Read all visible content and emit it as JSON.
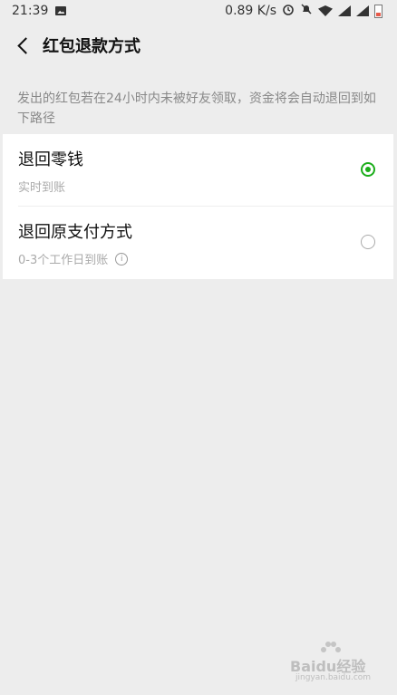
{
  "status_bar": {
    "time": "21:39",
    "net_speed": "0.89 K/s",
    "icons": [
      "image-icon",
      "alarm-icon",
      "mute-icon",
      "wifi-icon",
      "signal-icon",
      "signal-icon",
      "battery-icon"
    ]
  },
  "header": {
    "title": "红包退款方式",
    "back_icon": "back-arrow-icon"
  },
  "note": "发出的红包若在24小时内未被好友领取，资金将会自动退回到如下路径",
  "options": [
    {
      "name": "退回零钱",
      "sub": "实时到账",
      "selected": true
    },
    {
      "name": "退回原支付方式",
      "sub": "0-3个工作日到账",
      "selected": false,
      "info_icon": "i"
    }
  ],
  "colors": {
    "accent": "#1aad19",
    "background": "#ededed"
  },
  "watermark": {
    "text": "Baidu经验",
    "sub": "jingyan.baidu.com"
  }
}
